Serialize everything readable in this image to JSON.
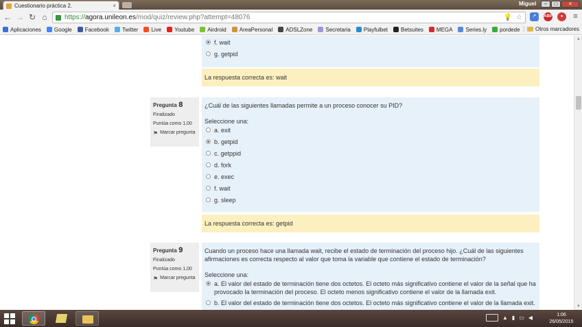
{
  "browser": {
    "tab_title": "Cuestionario práctica 2.",
    "tab_close": "×",
    "user_name": "Miguel",
    "url_scheme": "https://",
    "url_host": "agora.unileon.es",
    "url_path": "/mod/quiz/review.php?attempt=48076",
    "ext_abp": "ABP",
    "window_min": "‒",
    "window_max": "□",
    "window_close": "×"
  },
  "bookmarks": [
    {
      "label": "Aplicaciones",
      "icon": "apps-icon",
      "color": "#3b6fd6"
    },
    {
      "label": "Google",
      "icon": "google-icon",
      "color": "#4285f4"
    },
    {
      "label": "Facebook",
      "icon": "facebook-icon",
      "color": "#3b5998"
    },
    {
      "label": "Twitter",
      "icon": "twitter-icon",
      "color": "#55acee"
    },
    {
      "label": "Live",
      "icon": "live-icon",
      "color": "#f25022"
    },
    {
      "label": "Youtube",
      "icon": "youtube-icon",
      "color": "#e62117"
    },
    {
      "label": "Airdroid",
      "icon": "airdroid-icon",
      "color": "#7cbf3a"
    },
    {
      "label": "AreaPersonal",
      "icon": "areapersonal-icon",
      "color": "#c8963c"
    },
    {
      "label": "ADSLZone",
      "icon": "adslzone-icon",
      "color": "#444444"
    },
    {
      "label": "Secretaria",
      "icon": "secretaria-icon",
      "color": "#9a9ad6"
    },
    {
      "label": "Playfulbet",
      "icon": "playfulbet-icon",
      "color": "#2a8ad0"
    },
    {
      "label": "Betsuites",
      "icon": "betsuites-icon",
      "color": "#222222"
    },
    {
      "label": "MEGA",
      "icon": "mega-icon",
      "color": "#d9272e"
    },
    {
      "label": "Series.ly",
      "icon": "seriesly-icon",
      "color": "#5a8ad8"
    },
    {
      "label": "pordede",
      "icon": "pordede-icon",
      "color": "#3aa83a"
    }
  ],
  "other_bookmarks": "Otros marcadores",
  "prev_question": {
    "options": [
      {
        "label": "f. wait",
        "checked": true
      },
      {
        "label": "g. getpid",
        "checked": false
      }
    ],
    "feedback": "La respuesta correcta es: wait"
  },
  "q8": {
    "label": "Pregunta",
    "number": "8",
    "state": "Finalizado",
    "grade": "Puntúa como 1,00",
    "flag": "Marcar pregunta",
    "text": "¿Cuál de las siguientes llamadas permite a un proceso conocer su PID?",
    "select_one": "Seleccione una:",
    "options": [
      {
        "label": "a. exit",
        "checked": false
      },
      {
        "label": "b. getpid",
        "checked": true
      },
      {
        "label": "c. getppid",
        "checked": false
      },
      {
        "label": "d. fork",
        "checked": false
      },
      {
        "label": "e. exec",
        "checked": false
      },
      {
        "label": "f. wait",
        "checked": false
      },
      {
        "label": "g. sleep",
        "checked": false
      }
    ],
    "feedback": "La respuesta correcta es: getpid"
  },
  "q9": {
    "label": "Pregunta",
    "number": "9",
    "state": "Finalizado",
    "grade": "Puntúa como 1,00",
    "flag": "Marcar pregunta",
    "text": "Cuando un proceso hace una llamada wait, recibe el estado de terminación del proceso hijo. ¿Cuál de las siguientes afirmaciones es correcta respecto al valor que toma la variable que contiene el estado de terminación?",
    "select_one": "Seleccione una:",
    "options": [
      {
        "label": "a. El valor del estado de terminación tiene dos octetos. El octeto más significativo contiene el valor de la señal que ha provocado la terminación del proceso. El octeto menos significativo contiene el valor de la llamada exit.",
        "checked": true
      },
      {
        "label": "b. El valor del estado de terminación tiene dos octetos. El octeto más significativo contiene el valor de la llamada exit.",
        "checked": false
      }
    ]
  },
  "taskbar": {
    "time": "1:06",
    "date": "26/05/2015"
  }
}
